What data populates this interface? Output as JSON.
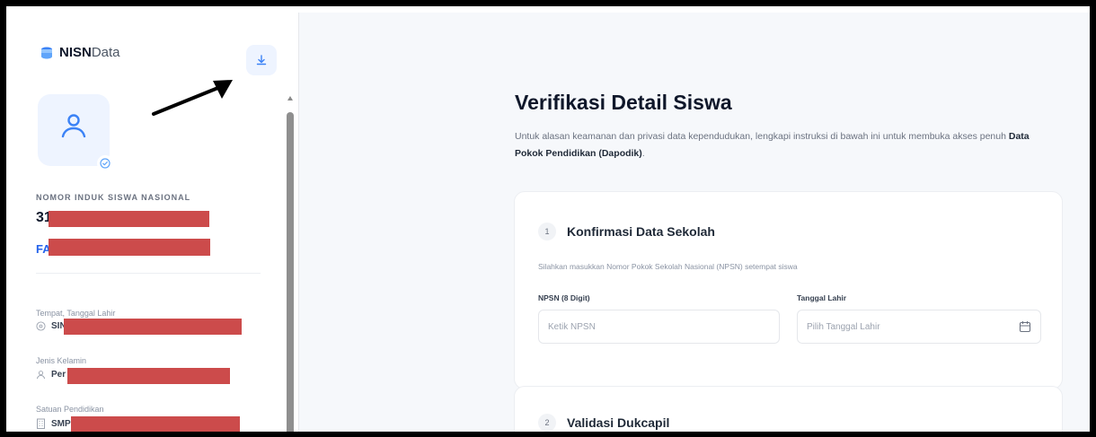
{
  "app": {
    "logo_bold": "NISN",
    "logo_light": "Data"
  },
  "profile": {
    "nisn_label": "NOMOR INDUK SISWA NASIONAL",
    "nisn_prefix": "31",
    "name_prefix": "FA",
    "fields": [
      {
        "label": "Tempat, Tanggal Lahir",
        "value_prefix": "SING",
        "icon": "location-icon"
      },
      {
        "label": "Jenis Kelamin",
        "value_prefix": "Per",
        "icon": "user-icon"
      },
      {
        "label": "Satuan Pendidikan",
        "value_prefix": "SMP",
        "icon": "building-icon"
      }
    ]
  },
  "main": {
    "title": "Verifikasi Detail Siswa",
    "desc_text": "Untuk alasan keamanan dan privasi data kependudukan, lengkapi instruksi di bawah ini untuk membuka akses penuh",
    "desc_bold": "Data Pokok Pendidikan (Dapodik)",
    "desc_end": ".",
    "steps": [
      {
        "number": "1",
        "title": "Konfirmasi Data Sekolah",
        "desc": "Silahkan masukkan Nomor Pokok Sekolah Nasional (NPSN) setempat siswa",
        "npsn_label": "NPSN (8 Digit)",
        "npsn_placeholder": "Ketik NPSN",
        "dob_label": "Tanggal Lahir",
        "dob_placeholder": "Pilih Tanggal Lahir"
      },
      {
        "number": "2",
        "title": "Validasi Dukcapil"
      }
    ]
  },
  "colors": {
    "accent": "#2563eb",
    "redaction": "#cc4b4b",
    "icon_bg": "#eef4ff"
  }
}
